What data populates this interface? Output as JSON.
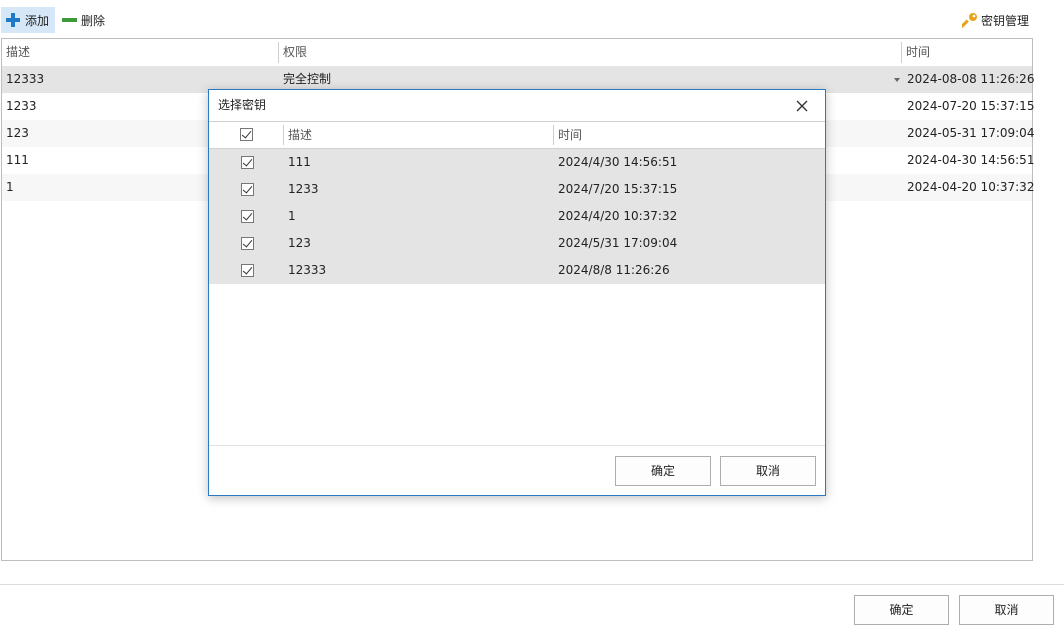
{
  "toolbar": {
    "add_label": "添加",
    "delete_label": "删除",
    "key_manage_label": "密钥管理"
  },
  "grid": {
    "columns": [
      "描述",
      "权限",
      "时间"
    ],
    "rows": [
      {
        "desc": "12333",
        "perm": "完全控制",
        "time": "2024-08-08 11:26:26"
      },
      {
        "desc": "1233",
        "perm": "",
        "time": "2024-07-20 15:37:15"
      },
      {
        "desc": "123",
        "perm": "",
        "time": "2024-05-31 17:09:04"
      },
      {
        "desc": "111",
        "perm": "",
        "time": "2024-04-30 14:56:51"
      },
      {
        "desc": "1",
        "perm": "",
        "time": "2024-04-20 10:37:32"
      }
    ]
  },
  "footer": {
    "ok_label": "确定",
    "cancel_label": "取消"
  },
  "dialog": {
    "title": "选择密钥",
    "columns": [
      "描述",
      "时间"
    ],
    "rows": [
      {
        "desc": "111",
        "time": "2024/4/30 14:56:51",
        "checked": true
      },
      {
        "desc": "1233",
        "time": "2024/7/20 15:37:15",
        "checked": true
      },
      {
        "desc": "1",
        "time": "2024/4/20 10:37:32",
        "checked": true
      },
      {
        "desc": "123",
        "time": "2024/5/31 17:09:04",
        "checked": true
      },
      {
        "desc": "12333",
        "time": "2024/8/8 11:26:26",
        "checked": true
      }
    ],
    "ok_label": "确定",
    "cancel_label": "取消"
  },
  "colors": {
    "accent": "#2b79c2",
    "add_icon": "#1f7ac8",
    "delete_icon": "#3d9a3a",
    "key_icon": "#e6a21a",
    "selected_row": "#e4e4e4"
  }
}
